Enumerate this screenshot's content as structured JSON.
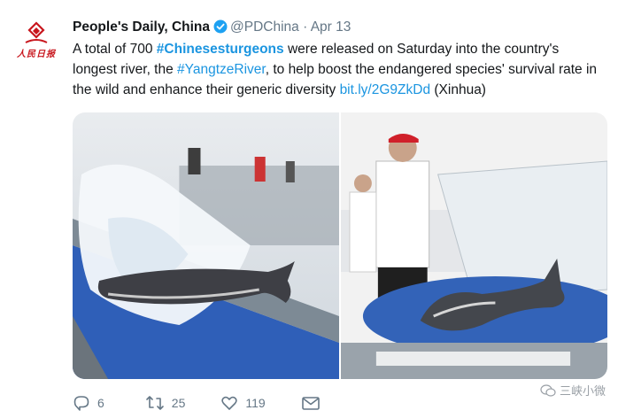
{
  "account": {
    "display_name": "People's Daily, China",
    "handle": "@PDChina",
    "separator": "·",
    "date": "Apr 13",
    "avatar_text": "人民日报"
  },
  "tweet": {
    "segment1": "A total of 700 ",
    "hashtag1": "#Chinesesturgeons",
    "segment2": " were released on Saturday into the country's longest river, the ",
    "hashtag2": "#YangtzeRiver",
    "segment3": ", to help boost the endangered species' survival rate in the wild and enhance their generic diversity ",
    "link": "bit.ly/2G9ZkDd",
    "segment4": " (Xinhua)"
  },
  "media": {
    "photos": [
      {
        "description_icon": "sturgeon-splash-photo"
      },
      {
        "description_icon": "sturgeon-release-photo"
      }
    ]
  },
  "actions": {
    "reply_count": "6",
    "retweet_count": "25",
    "like_count": "119"
  },
  "watermark": {
    "text": "三峡小微"
  },
  "colors": {
    "link": "#1b95e0",
    "verified": "#1da1f2",
    "secondary": "#657786",
    "brand_red": "#c8161d"
  }
}
